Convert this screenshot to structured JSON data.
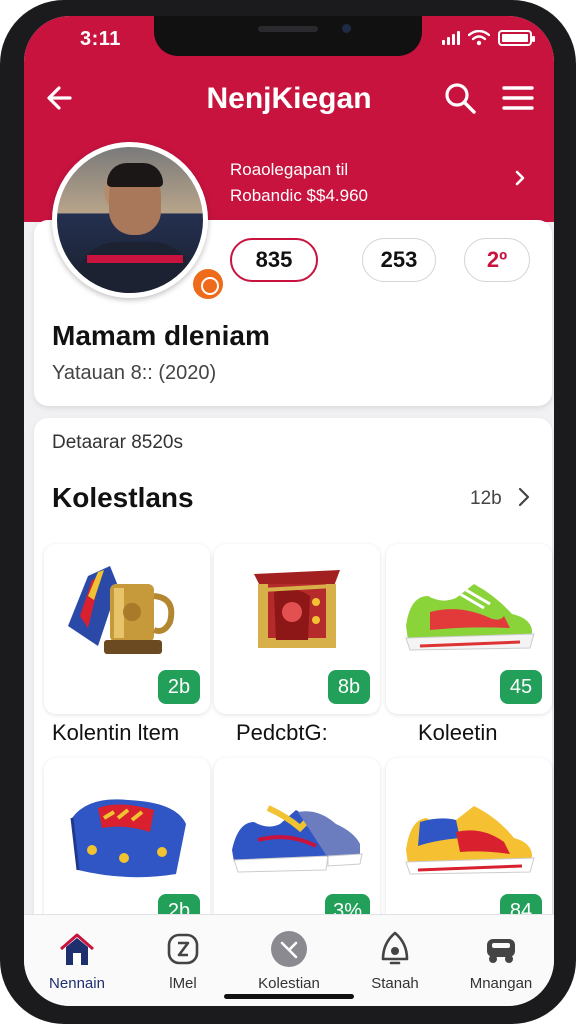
{
  "status_bar": {
    "time": "3:11"
  },
  "header": {
    "title": "NenjKiegan",
    "promo_line1": "Roaolegapan til",
    "promo_line2": "Robandic $$4.960"
  },
  "profile": {
    "stats": [
      "835",
      "253",
      "2º"
    ],
    "name": "Mamam dleniam",
    "since": "Yatauan 8:: (2020)"
  },
  "collection": {
    "subtitle": "Detaarar 8520s",
    "title": "Kolestlans",
    "count": "12b",
    "items": [
      {
        "icon": "trophy-icon",
        "count": "2b"
      },
      {
        "icon": "treasure-box-icon",
        "count": "8b"
      },
      {
        "icon": "green-sneaker-icon",
        "count": "45"
      },
      {
        "icon": "blue-bag-icon",
        "count": "2b"
      },
      {
        "icon": "blue-sneaker-icon",
        "count": "3%"
      },
      {
        "icon": "yellow-sneaker-icon",
        "count": "84"
      }
    ],
    "row_labels": [
      "Kolentin ltem",
      "PedcbtG:",
      "Koleetin"
    ]
  },
  "nav": [
    {
      "label": "Nennain",
      "icon": "home-icon"
    },
    {
      "label": "lMel",
      "icon": "timer-icon"
    },
    {
      "label": "Kolestian",
      "icon": "check-circle-icon"
    },
    {
      "label": "Stanah",
      "icon": "bell-icon"
    },
    {
      "label": "Mnangan",
      "icon": "vehicle-icon"
    }
  ],
  "colors": {
    "brand": "#c8133f",
    "badge": "#22a05a",
    "nav_active": "#1e2f6e"
  }
}
